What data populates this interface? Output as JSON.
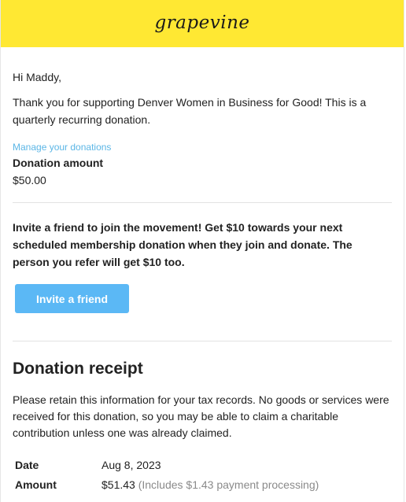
{
  "brand": {
    "logo_text": "grapevine",
    "header_color": "#ffe833"
  },
  "greeting": "Hi Maddy,",
  "thanks": "Thank you for supporting Denver Women in Business for Good! This is a quarterly recurring donation.",
  "manage_link": "Manage your donations",
  "donation": {
    "label": "Donation amount",
    "value": "$50.00"
  },
  "invite": {
    "text": "Invite a friend to join the movement! Get $10 towards your next scheduled membership donation when they join and donate. The person you refer will get $10 too.",
    "button": "Invite a friend"
  },
  "receipt": {
    "title": "Donation receipt",
    "note": "Please retain this information for your tax records. No goods or services were received for this donation, so you may be able to claim a charitable contribution unless one was already claimed.",
    "rows": [
      {
        "label": "Date",
        "value": "Aug 8, 2023",
        "note": ""
      },
      {
        "label": "Amount",
        "value": "$51.43",
        "note": "(Includes $1.43 payment processing)"
      }
    ]
  },
  "colors": {
    "link": "#5bb6e6",
    "button": "#5bb8f5"
  }
}
